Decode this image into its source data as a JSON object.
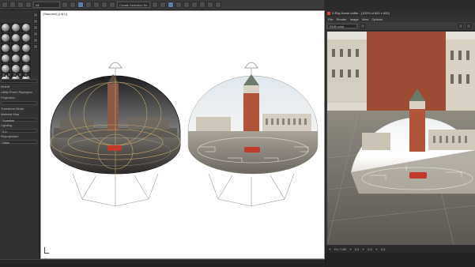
{
  "toolbar": {
    "dropdown_1": "All",
    "dropdown_2": "Create Selection Se"
  },
  "left_panel": {
    "material_slots": 18,
    "labels": [
      "Inherit",
      "Utility Prmtv Reproject",
      "Projection",
      "Transform Mode",
      "Material Map",
      "Lighting",
      "Reprojection"
    ],
    "row_values": [
      "Scanline",
      "0.0",
      "Stick"
    ]
  },
  "viewport": {
    "label": "[Standard] [Lit(1)]"
  },
  "render_window": {
    "title": "V-Ray frame buffer - [100% of 600 x 600]",
    "menu": [
      "File",
      "Render",
      "Image",
      "View",
      "Options"
    ],
    "display_dropdown": "RGB color",
    "status_text": "Fri, 7:55",
    "status_values": [
      "1/1",
      "0.0",
      "0.0"
    ]
  },
  "colors": {
    "ui_dark": "#2b2b2b",
    "viewport_bg": "#ffffff",
    "gizmo": "#c4a36a",
    "tower": "#b0553a",
    "car": "#c0392b"
  }
}
